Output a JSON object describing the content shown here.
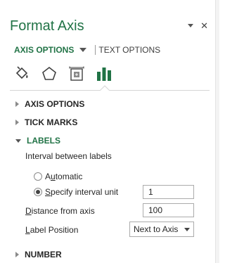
{
  "pane": {
    "title": "Format Axis"
  },
  "tabs": {
    "active": "AXIS OPTIONS",
    "other": "TEXT OPTIONS"
  },
  "icons": [
    "fill-line-icon",
    "effects-icon",
    "size-properties-icon",
    "axis-options-icon"
  ],
  "sections": {
    "axis_options": "AXIS OPTIONS",
    "tick_marks": "TICK MARKS",
    "labels": "LABELS",
    "number": "NUMBER"
  },
  "labels": {
    "interval_label": "Interval between labels",
    "automatic_label": "Automatic",
    "specify_label": "Specify interval unit",
    "selected_option": "specify",
    "interval_value": "1",
    "distance_label": "Distance from axis",
    "distance_value": "100",
    "position_label": "Label Position",
    "position_value": "Next to Axis"
  },
  "colors": {
    "accent": "#217346",
    "text": "#262626"
  }
}
